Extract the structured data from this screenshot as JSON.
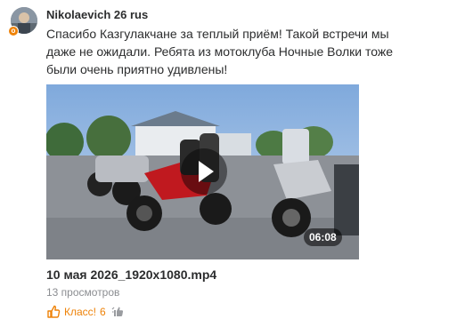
{
  "post": {
    "author": "Nikolaevich 26 rus",
    "badge": "o",
    "text": "Спасибо Казгулакчане за теплый приём! Такой встречи мы даже не ожидали. Ребята из мотоклуба Ночные Волки тоже были очень приятно удивлены!"
  },
  "video": {
    "duration": "06:08",
    "file_title": "10 мая 2026_1920x1080.mp4",
    "views": "13 просмотров"
  },
  "reactions": {
    "like_label": "Класс!",
    "like_count": "6"
  },
  "colors": {
    "accent": "#ee8208",
    "text": "#2c2d2e",
    "secondary": "#8b8d91"
  },
  "icons": [
    "avatar",
    "ok-badge-icon",
    "play-icon",
    "thumb-up-icon",
    "share-icon"
  ]
}
